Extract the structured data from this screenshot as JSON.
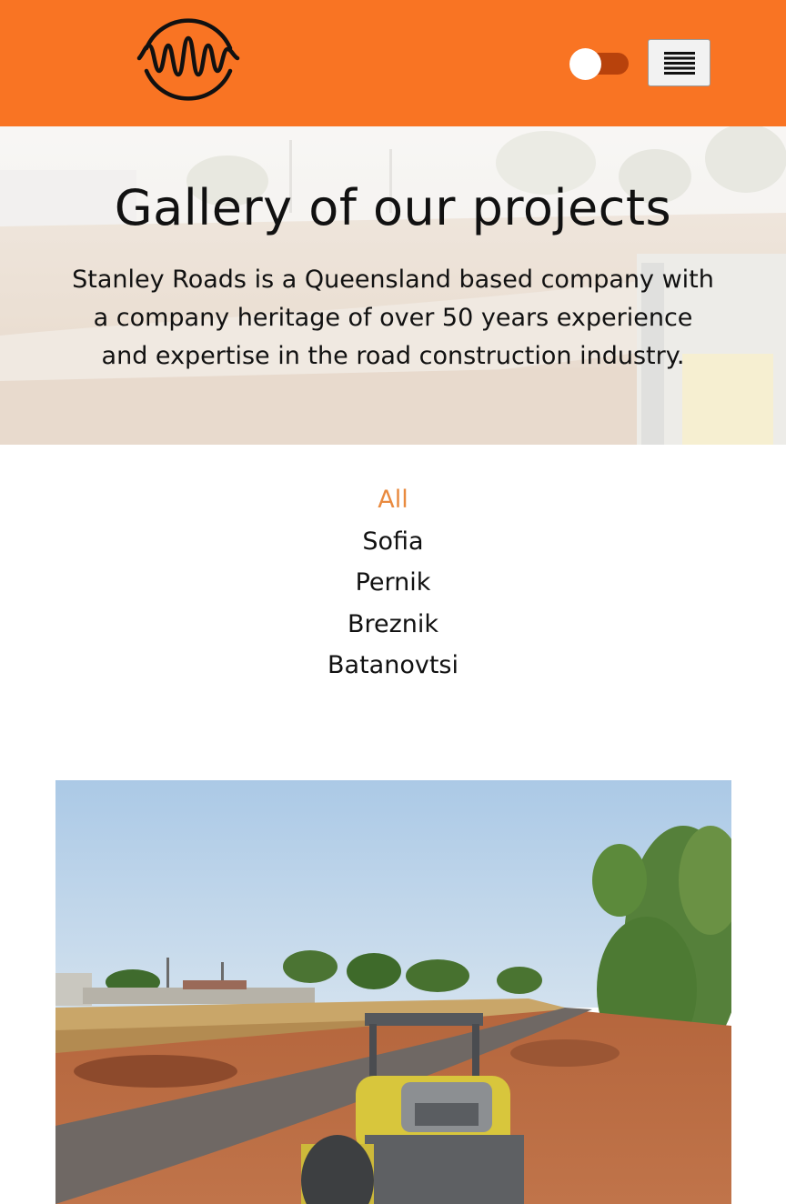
{
  "header": {
    "logo_icon": "sound-wave-circle-logo",
    "toggle_icon": "theme-toggle",
    "menu_icon": "hamburger-menu-icon",
    "colors": {
      "background": "#f97423",
      "toggle_track": "#b8420c",
      "toggle_knob": "#ffffff"
    }
  },
  "hero": {
    "title": "Gallery of our projects",
    "description": "Stanley Roads is a Queensland based company with a company heritage of over 50 years experience and expertise in the road construction industry."
  },
  "filters": {
    "active_color": "#e98a3f",
    "items": [
      {
        "label": "All",
        "active": true
      },
      {
        "label": "Sofia",
        "active": false
      },
      {
        "label": "Pernik",
        "active": false
      },
      {
        "label": "Breznik",
        "active": false
      },
      {
        "label": "Batanovtsi",
        "active": false
      }
    ]
  },
  "gallery": {
    "image_icon": "road-roller-construction-photo"
  }
}
